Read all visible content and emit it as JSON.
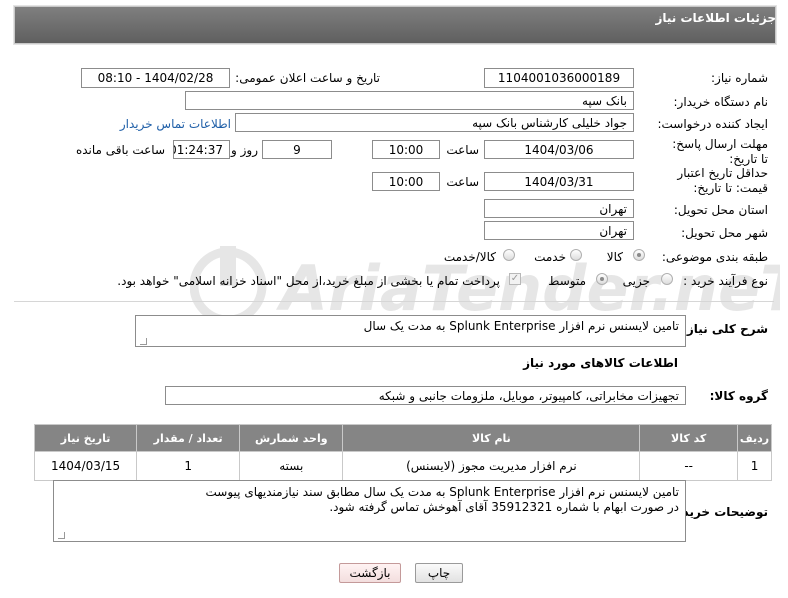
{
  "header": {
    "title": "جزئیات اطلاعات نیاز"
  },
  "form": {
    "need_number": {
      "label": "شماره نیاز:",
      "value": "1104001036000189"
    },
    "announce_datetime": {
      "label": "تاریخ و ساعت اعلان عمومی:",
      "value": "1404/02/28 - 08:10"
    },
    "buyer_org": {
      "label": "نام دستگاه خریدار:",
      "value": "بانک سپه"
    },
    "requester": {
      "label": "ایجاد کننده درخواست:",
      "value": "جواد خلیلی کارشناس بانک سپه"
    },
    "buyer_contact_link": "اطلاعات تماس خریدار",
    "reply_deadline": {
      "label": "مهلت ارسال پاسخ: تا تاریخ:",
      "date": "1404/03/06",
      "time_label": "ساعت",
      "time": "10:00",
      "days": "9",
      "days_label": "روز و",
      "remaining": "01:24:37",
      "remaining_label": "ساعت باقی مانده"
    },
    "price_validity": {
      "label": "حداقل تاریخ اعتبار قیمت: تا تاریخ:",
      "date": "1404/03/31",
      "time_label": "ساعت",
      "time": "10:00"
    },
    "delivery_province": {
      "label": "استان محل تحویل:",
      "value": "تهران"
    },
    "delivery_city": {
      "label": "شهر محل تحویل:",
      "value": "تهران"
    },
    "category": {
      "label": "طبقه بندی موضوعی:",
      "options": [
        "کالا",
        "خدمت",
        "کالا/خدمت"
      ],
      "selected": "کالا"
    },
    "process_type": {
      "label": "نوع فرآیند خرید :",
      "options": [
        "جزیی",
        "متوسط"
      ],
      "selected": "متوسط",
      "payment_note": "پرداخت تمام یا بخشی از مبلغ خرید،از محل \"اسناد خزانه اسلامی\" خواهد بود."
    }
  },
  "description": {
    "label": "شرح کلی نیاز:",
    "value": "تامین لایسنس نرم افزار Splunk Enterprise  به مدت یک سال"
  },
  "goods_section_title": "اطلاعات کالاهای مورد نیاز",
  "goods_group": {
    "label": "گروه کالا:",
    "value": "تجهیزات مخابراتی، کامپیوتر، موبایل، ملزومات جانبی و شبکه"
  },
  "table": {
    "headers": [
      "ردیف",
      "کد کالا",
      "نام کالا",
      "واحد شمارش",
      "تعداد / مقدار",
      "تاریخ نیاز"
    ],
    "rows": [
      [
        "1",
        "--",
        "نرم افزار مدیریت مجوز (لایسنس)",
        "بسته",
        "1",
        "1404/03/15"
      ]
    ]
  },
  "buyer_notes": {
    "label": "توضیحات خریدار:",
    "line1": "تامین لایسنس نرم افزار Splunk Enterprise  به مدت یک سال مطابق سند نیازمندیهای پیوست",
    "line2": "در صورت ابهام با شماره 35912321 آقای آهوخش تماس گرفته شود."
  },
  "buttons": {
    "print": "چاپ",
    "back": "بازگشت"
  },
  "watermark": "AriaTender.neT"
}
